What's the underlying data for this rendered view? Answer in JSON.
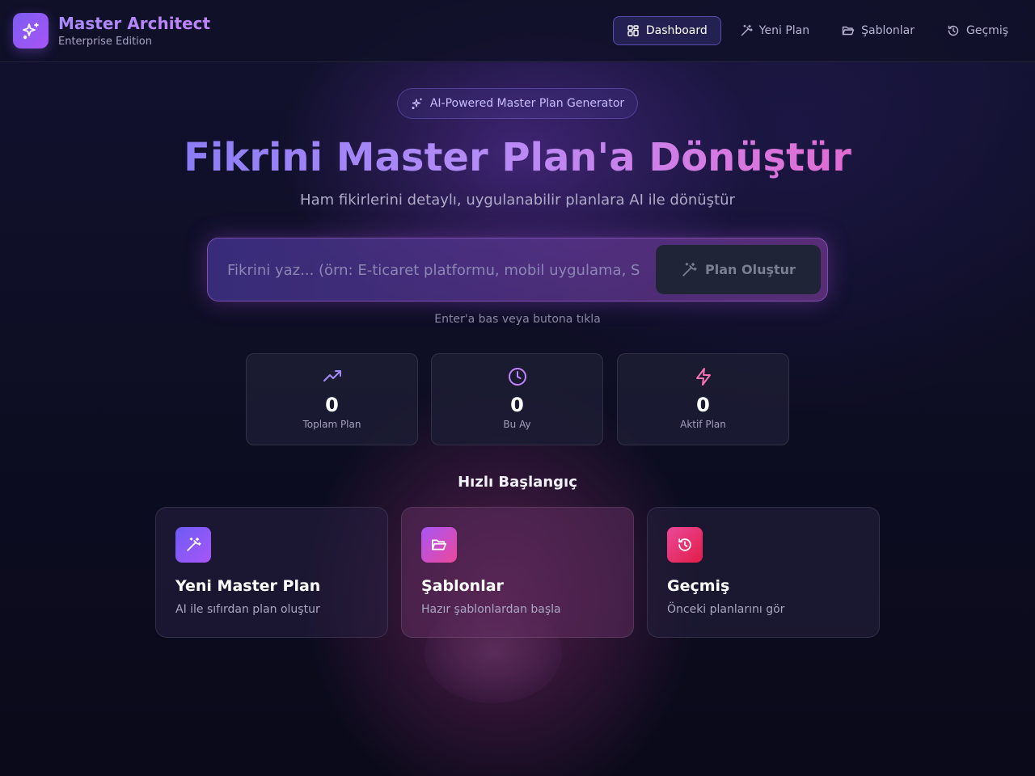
{
  "header": {
    "brand_title": "Master Architect",
    "brand_subtitle": "Enterprise Edition",
    "logo_icon": "sparkles-icon",
    "nav": [
      {
        "label": "Dashboard",
        "icon": "grid-icon",
        "active": true
      },
      {
        "label": "Yeni Plan",
        "icon": "magic-wand-icon",
        "active": false
      },
      {
        "label": "Şablonlar",
        "icon": "folder-open-icon",
        "active": false
      },
      {
        "label": "Geçmiş",
        "icon": "history-icon",
        "active": false
      }
    ]
  },
  "hero": {
    "badge": "AI-Powered Master Plan Generator",
    "title": "Fikrini Master Plan'a Dönüştür",
    "subtitle": "Ham fikirlerini detaylı, uygulanabilir planlara AI ile dönüştür",
    "input_placeholder": "Fikrini yaz... (örn: E-ticaret platformu, mobil uygulama, SaaS ürünü)",
    "input_value": "",
    "button_label": "Plan Oluştur",
    "hint": "Enter'a bas veya butona tıkla"
  },
  "stats": [
    {
      "value": "0",
      "label": "Toplam Plan",
      "icon": "trending-up-icon",
      "color": "#a78bfa"
    },
    {
      "value": "0",
      "label": "Bu Ay",
      "icon": "clock-icon",
      "color": "#c084fc"
    },
    {
      "value": "0",
      "label": "Aktif Plan",
      "icon": "bolt-icon",
      "color": "#f472b6"
    }
  ],
  "quick_start": {
    "title": "Hızlı Başlangıç",
    "cards": [
      {
        "title": "Yeni Master Plan",
        "description": "AI ile sıfırdan plan oluştur",
        "icon": "magic-wand-icon"
      },
      {
        "title": "Şablonlar",
        "description": "Hazır şablonlardan başla",
        "icon": "folder-open-icon"
      },
      {
        "title": "Geçmiş",
        "description": "Önceki planlarını gör",
        "icon": "history-icon"
      }
    ]
  },
  "colors": {
    "accent_purple": "#8b5cf6",
    "accent_pink": "#ec4899",
    "background": "#0b0b1c"
  }
}
